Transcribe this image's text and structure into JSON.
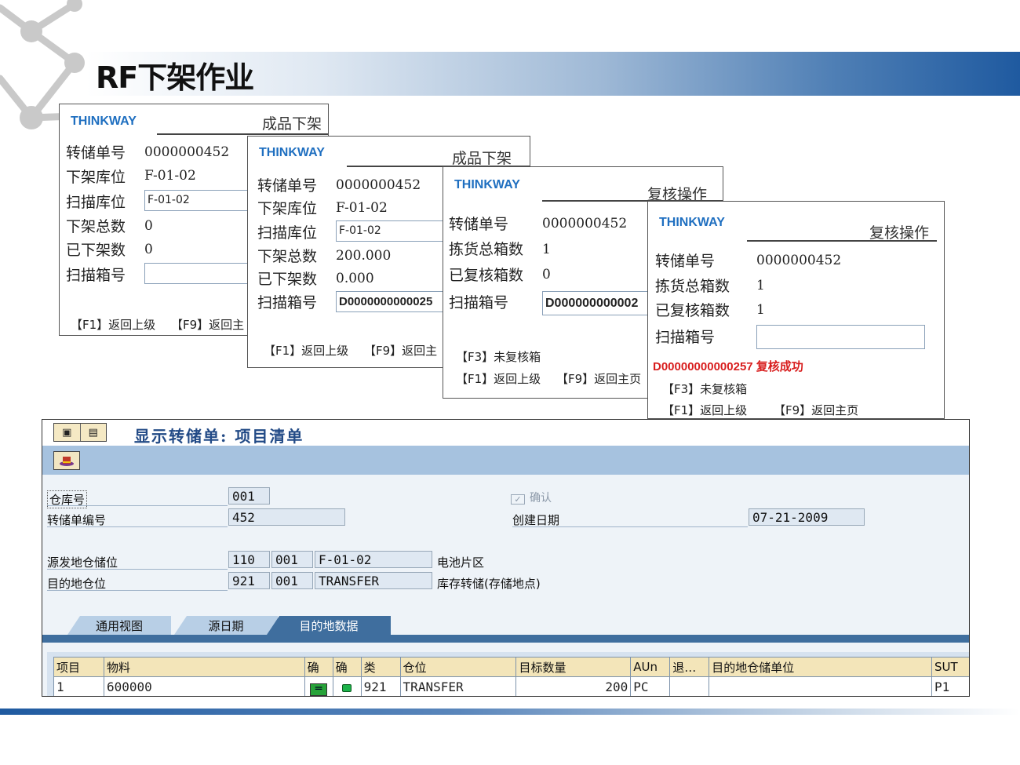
{
  "slide": {
    "title": "RF下架作业"
  },
  "rf_panels": [
    {
      "brand": "THINKWAY",
      "title": "成品下架",
      "rows": [
        {
          "label": "转储单号",
          "value": "0000000452",
          "kind": "text"
        },
        {
          "label": "下架库位",
          "value": "F-01-02",
          "kind": "text"
        },
        {
          "label": "扫描库位",
          "value": "F-01-02",
          "kind": "input"
        },
        {
          "label": "下架总数",
          "value": "0",
          "kind": "text"
        },
        {
          "label": "已下架数",
          "value": "0",
          "kind": "text"
        },
        {
          "label": "扫描箱号",
          "value": "",
          "kind": "input"
        }
      ],
      "fkeys": [
        "【F1】返回上级",
        "【F9】返回主"
      ]
    },
    {
      "brand": "THINKWAY",
      "title": "成品下架",
      "rows": [
        {
          "label": "转储单号",
          "value": "0000000452",
          "kind": "text"
        },
        {
          "label": "下架库位",
          "value": "F-01-02",
          "kind": "text"
        },
        {
          "label": "扫描库位",
          "value": "F-01-02",
          "kind": "input"
        },
        {
          "label": "下架总数",
          "value": "200.000",
          "kind": "text"
        },
        {
          "label": "已下架数",
          "value": "0.000",
          "kind": "text"
        },
        {
          "label": "扫描箱号",
          "value": "D0000000000025",
          "kind": "input"
        }
      ],
      "fkeys": [
        "【F1】返回上级",
        "【F9】返回主"
      ]
    },
    {
      "brand": "THINKWAY",
      "title": "复核操作",
      "rows": [
        {
          "label": "转储单号",
          "value": "0000000452",
          "kind": "text"
        },
        {
          "label": "拣货总箱数",
          "value": "1",
          "kind": "text"
        },
        {
          "label": "已复核箱数",
          "value": "0",
          "kind": "text"
        },
        {
          "label": "扫描箱号",
          "value": "D000000000002",
          "kind": "input"
        }
      ],
      "fkeys": [
        "【F3】未复核箱",
        "【F1】返回上级",
        "【F9】返回主页"
      ]
    },
    {
      "brand": "THINKWAY",
      "title": "复核操作",
      "rows": [
        {
          "label": "转储单号",
          "value": "0000000452",
          "kind": "text"
        },
        {
          "label": "拣货总箱数",
          "value": "1",
          "kind": "text"
        },
        {
          "label": "已复核箱数",
          "value": "1",
          "kind": "text"
        },
        {
          "label": "扫描箱号",
          "value": "",
          "kind": "input"
        }
      ],
      "message": "D00000000000257 复核成功",
      "fkeys": [
        "【F3】未复核箱",
        "【F1】返回上级",
        "【F9】返回主页"
      ]
    }
  ],
  "sap": {
    "title": "显示转储单: 项目清单",
    "warehouse_label": "仓库号",
    "warehouse_value": "001",
    "confirm_label": "确认",
    "to_number_label": "转储单编号",
    "to_number_value": "452",
    "created_label": "创建日期",
    "created_value": "07-21-2009",
    "source_label": "源发地仓储位",
    "source_type": "110",
    "source_wh": "001",
    "source_bin": "F-01-02",
    "source_desc": "电池片区",
    "dest_label": "目的地仓位",
    "dest_type": "921",
    "dest_wh": "001",
    "dest_bin": "TRANSFER",
    "dest_desc": "库存转储(存储地点)",
    "tabs": [
      "通用视图",
      "源日期",
      "目的地数据"
    ],
    "table": {
      "headers": [
        "项目",
        "物料",
        "确",
        "确",
        "类",
        "仓位",
        "目标数量",
        "AUn",
        "退…",
        "目的地仓储单位",
        "SUT"
      ],
      "rows": [
        {
          "item": "1",
          "material": "600000",
          "type": "921",
          "bin": "TRANSFER",
          "qty": "200",
          "aun": "PC",
          "ret": "",
          "dest_su": "",
          "sut": "P1"
        }
      ]
    }
  }
}
